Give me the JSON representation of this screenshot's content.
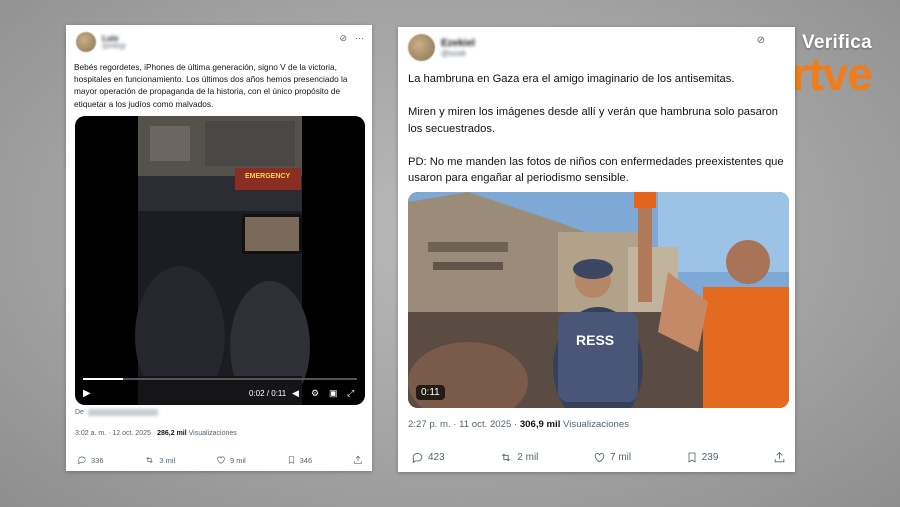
{
  "watermark": {
    "verifica": "Verifica",
    "brand": "rtve",
    "brand_color": "#f07c1a"
  },
  "tweets": [
    {
      "author_name": "Luis",
      "author_handle": "@ellegi",
      "text": "Bebés regordetes, iPhones de última generación, signo V de la victoria, hospitales en funcionamiento. Los últimos dos años hemos presenciado la mayor operación de propaganda de la historia, con el único propósito de etiquetar a los judíos como malvados.",
      "video_time": "0:02 / 0:11",
      "video_sign": "EMERGENCY",
      "source_prefix": "De",
      "time": "3:02 a. m. · 12 oct. 2025 ·",
      "views": "286,2 mil",
      "views_label": "Visualizaciones",
      "replies": "336",
      "retweets": "3 mil",
      "likes": "9 mil",
      "bookmarks": "346"
    },
    {
      "author_name": "Ezekiel",
      "author_handle": "@ezek",
      "text": "La hambruna en Gaza era el amigo imaginario de los antisemitas.\n\nMiren y miren los imágenes desde allí y verán que hambruna solo pasaron los secuestrados.\n\nPD: No me manden las fotos de niños con enfermedades preexistentes que usaron para engañar al periodismo sensible.",
      "video_duration": "0:11",
      "vest_text": "RESS",
      "time": "2:27 p. m. · 11 oct. 2025 ·",
      "views": "306,9 mil",
      "views_label": "Visualizaciones",
      "replies": "423",
      "retweets": "2 mil",
      "likes": "7 mil",
      "bookmarks": "239"
    }
  ]
}
